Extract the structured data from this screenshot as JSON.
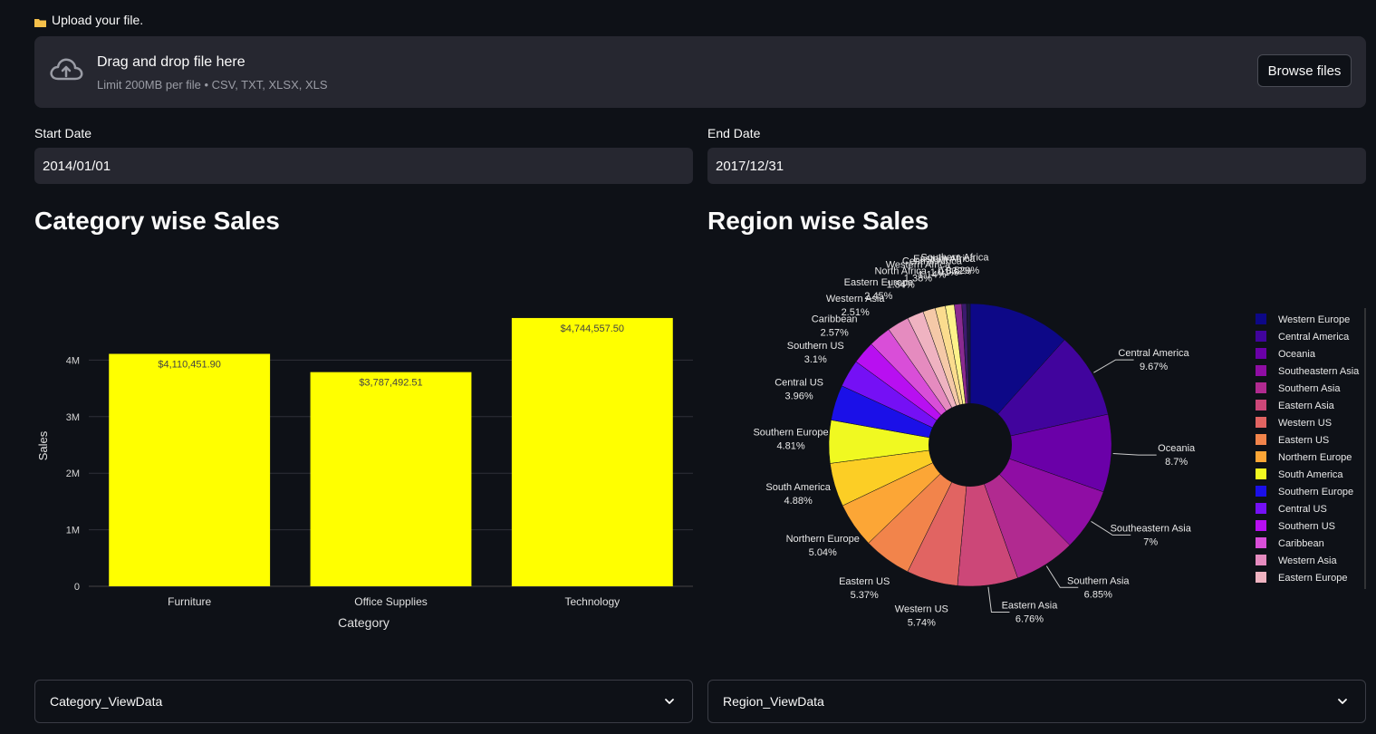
{
  "uploader": {
    "label": "Upload your file.",
    "drop_title": "Drag and drop file here",
    "drop_hint": "Limit 200MB per file • CSV, TXT, XLSX, XLS",
    "browse_label": "Browse files"
  },
  "dates": {
    "start_label": "Start Date",
    "start_value": "2014/01/01",
    "end_label": "End Date",
    "end_value": "2017/12/31"
  },
  "sections": {
    "category_title": "Category wise Sales",
    "region_title": "Region wise Sales"
  },
  "expanders": {
    "category": "Category_ViewData",
    "region": "Region_ViewData"
  },
  "chart_data": [
    {
      "type": "bar",
      "categories": [
        "Furniture",
        "Office Supplies",
        "Technology"
      ],
      "values": [
        4110451.9,
        3787492.51,
        4744557.5
      ],
      "data_labels": [
        "$4,110,451.90",
        "$3,787,492.51",
        "$4,744,557.50"
      ],
      "xlabel": "Category",
      "ylabel": "Sales",
      "ylim": [
        0,
        5000000
      ],
      "yticks": [
        0,
        1000000,
        2000000,
        3000000,
        4000000
      ],
      "ytick_labels": [
        "0",
        "1M",
        "2M",
        "3M",
        "4M"
      ],
      "bar_color": "#ffff00",
      "grid": true
    },
    {
      "type": "pie",
      "hole": true,
      "slices": [
        {
          "name": "Western Europe",
          "value": 11.4,
          "label": "",
          "color": "#0d0887"
        },
        {
          "name": "Central America",
          "value": 9.67,
          "label": "9.67%",
          "color": "#41049d"
        },
        {
          "name": "Oceania",
          "value": 8.7,
          "label": "8.7%",
          "color": "#6a00a8"
        },
        {
          "name": "Southeastern Asia",
          "value": 7,
          "label": "7%",
          "color": "#8f0da4"
        },
        {
          "name": "Southern Asia",
          "value": 6.85,
          "label": "6.85%",
          "color": "#b12a90"
        },
        {
          "name": "Eastern Asia",
          "value": 6.76,
          "label": "6.76%",
          "color": "#cc4778"
        },
        {
          "name": "Western US",
          "value": 5.74,
          "label": "5.74%",
          "color": "#e16462"
        },
        {
          "name": "Eastern US",
          "value": 5.37,
          "label": "5.37%",
          "color": "#f2844b"
        },
        {
          "name": "Northern Europe",
          "value": 5.04,
          "label": "5.04%",
          "color": "#fca636"
        },
        {
          "name": "South America",
          "value": 4.88,
          "label": "4.88%",
          "color": "#fcce25"
        },
        {
          "name": "Southern Europe",
          "value": 4.81,
          "label": "4.81%",
          "color": "#f0f921"
        },
        {
          "name": "Central US",
          "value": 3.96,
          "label": "3.96%",
          "color": "#1b10e8"
        },
        {
          "name": "Southern US",
          "value": 3.1,
          "label": "3.1%",
          "color": "#7510f5"
        },
        {
          "name": "Caribbean",
          "value": 2.57,
          "label": "2.57%",
          "color": "#b80ff1"
        },
        {
          "name": "Western Asia",
          "value": 2.51,
          "label": "2.51%",
          "color": "#d94ed8"
        },
        {
          "name": "Eastern Europe",
          "value": 2.45,
          "label": "2.45%",
          "color": "#e58bbf"
        },
        {
          "name": "North Africa",
          "value": 1.84,
          "label": "1.84%",
          "color": "#efb3c1"
        },
        {
          "name": "Western Africa",
          "value": 1.38,
          "label": "1.38%",
          "color": "#f5c9a8"
        },
        {
          "name": "Central Africa",
          "value": 1.14,
          "label": "1.14%",
          "color": "#fbdc8e"
        },
        {
          "name": "Eastern Africa",
          "value": 1.01,
          "label": "1.01%",
          "color": "#fdf28a"
        },
        {
          "name": "Southern Africa",
          "value": 0.832,
          "label": "0.832%",
          "color": "#8a2a90"
        },
        {
          "name": "",
          "value": 0.529,
          "label": "0.529%",
          "color": "#3b1a6e"
        },
        {
          "name": "",
          "value": 0.4,
          "label": "",
          "color": "#1a1a3a"
        }
      ],
      "legend_entries": [
        "Western Europe",
        "Central America",
        "Oceania",
        "Southeastern Asia",
        "Southern Asia",
        "Eastern Asia",
        "Western US",
        "Eastern US",
        "Northern Europe",
        "South America",
        "Southern Europe",
        "Central US",
        "Southern US",
        "Caribbean",
        "Western Asia",
        "Eastern Europe"
      ],
      "legend_colors": [
        "#0d0887",
        "#41049d",
        "#6a00a8",
        "#8f0da4",
        "#b12a90",
        "#cc4778",
        "#e16462",
        "#f2844b",
        "#fca636",
        "#f0f921",
        "#1b10e8",
        "#7510f5",
        "#b80ff1",
        "#d94ed8",
        "#e58bbf",
        "#efb3c1"
      ],
      "legend_placement": "right"
    }
  ]
}
